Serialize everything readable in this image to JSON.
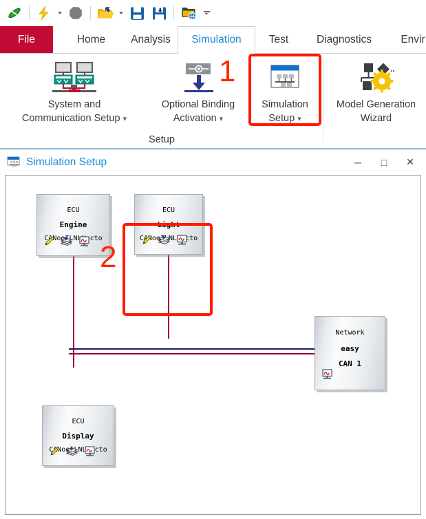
{
  "quick_access": {
    "items": [
      {
        "name": "canoe-logo-icon",
        "label": "CANoe",
        "type": "icon"
      },
      {
        "name": "start-measurement-icon",
        "label": "Start Measurement",
        "type": "icon"
      },
      {
        "name": "start-measurement-dropdown",
        "label": "",
        "type": "caret"
      },
      {
        "name": "stop-measurement-icon",
        "label": "Stop Measurement",
        "type": "icon"
      },
      {
        "name": "open-configuration-icon",
        "label": "Open Configuration",
        "type": "icon"
      },
      {
        "name": "open-configuration-dropdown",
        "label": "",
        "type": "caret"
      },
      {
        "name": "save-configuration-icon",
        "label": "Save Configuration",
        "type": "icon"
      },
      {
        "name": "save-configuration-as-icon",
        "label": "Save Configuration As",
        "type": "icon"
      },
      {
        "name": "configuration-folder-icon",
        "label": "Configuration Folder",
        "type": "icon"
      },
      {
        "name": "customize-quick-access-dropdown",
        "label": "",
        "type": "caret-big"
      }
    ]
  },
  "ribbon": {
    "tabs": [
      {
        "label": "File",
        "active": false,
        "file": true
      },
      {
        "label": "Home",
        "active": false,
        "file": false
      },
      {
        "label": "Analysis",
        "active": false,
        "file": false
      },
      {
        "label": "Simulation",
        "active": true,
        "file": false
      },
      {
        "label": "Test",
        "active": false,
        "file": false
      },
      {
        "label": "Diagnostics",
        "active": false,
        "file": false
      },
      {
        "label": "Envir",
        "active": false,
        "file": false
      }
    ],
    "group_title": "Setup",
    "buttons": {
      "system_comm_setup": {
        "line1": "System and",
        "line2": "Communication Setup",
        "dropdown": "▾"
      },
      "optional_binding": {
        "line1": "Optional Binding",
        "line2": "Activation",
        "dropdown": "▾"
      },
      "simulation_setup": {
        "line1": "Simulation",
        "line2": "Setup",
        "dropdown": "▾"
      },
      "model_generation_wizard": {
        "line1": "Model Generation",
        "line2": "Wizard",
        "dropdown": ""
      }
    }
  },
  "annotations": [
    {
      "name": "annotation-number-1",
      "text": "1"
    },
    {
      "name": "annotation-number-2",
      "text": "2"
    }
  ],
  "window": {
    "title": "Simulation Setup",
    "controls": {
      "minimize": "─",
      "maximize": "□",
      "close": "✕"
    }
  },
  "diagram": {
    "nodes": [
      {
        "id": "ecu-engine",
        "kind": "ecu",
        "line1": "ECU",
        "line2": "Engine",
        "line3": "CANoeILNLVecto",
        "icons": [
          "pencil-icon",
          "database-stack-icon",
          "monitor-panel-icon"
        ]
      },
      {
        "id": "ecu-light",
        "kind": "ecu",
        "line1": "ECU",
        "line2": "Light",
        "line3": "CANoeILNLVecto",
        "icons": [
          "pencil-icon",
          "database-stack-icon",
          "monitor-panel-icon"
        ]
      },
      {
        "id": "ecu-display",
        "kind": "ecu",
        "line1": "ECU",
        "line2": "Display",
        "line3": "CANoeILNLVecto",
        "icons": [
          "pencil-icon",
          "database-stack-icon",
          "monitor-panel-icon"
        ]
      },
      {
        "id": "network-easy-can1",
        "kind": "network",
        "line1": "Network",
        "line2": "easy",
        "line3": "CAN 1",
        "icons": [
          "monitor-panel-icon"
        ]
      }
    ]
  },
  "colors": {
    "file_tab": "#c10a34",
    "accent_blue": "#1c8ad8",
    "annotation_red": "#ff1a00",
    "bus_line_navy": "#1a1a6e",
    "bus_line_maroon": "#990033",
    "node_border": "#a8aeb4"
  }
}
